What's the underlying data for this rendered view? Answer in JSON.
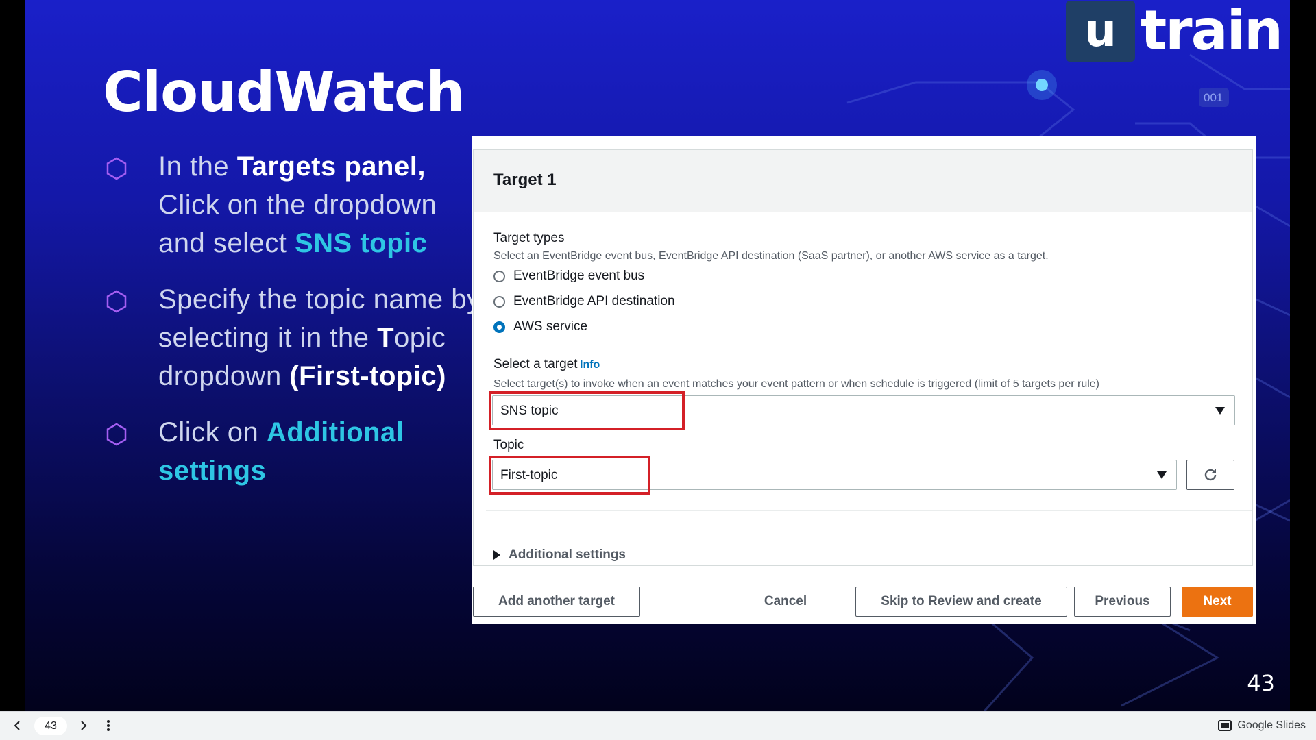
{
  "slide": {
    "title": "CloudWatch",
    "page_number": "43",
    "logo": {
      "box": "u",
      "text": "train"
    },
    "deco_label": "001",
    "bullets": [
      {
        "parts": [
          {
            "text": "In the ",
            "style": "n"
          },
          {
            "text": "Targets panel,",
            "style": "w"
          },
          {
            "text": " Click on the dropdown and select ",
            "style": "n"
          },
          {
            "text": "SNS topic",
            "style": "c"
          }
        ]
      },
      {
        "parts": [
          {
            "text": "Specify the topic name by selecting it in the ",
            "style": "n"
          },
          {
            "text": "T",
            "style": "w"
          },
          {
            "text": "opic dropdown ",
            "style": "n"
          },
          {
            "text": "(First-topic)",
            "style": "w"
          }
        ]
      },
      {
        "parts": [
          {
            "text": "Click on ",
            "style": "n"
          },
          {
            "text": "Additional settings",
            "style": "c"
          }
        ]
      }
    ]
  },
  "aws": {
    "header": "Target 1",
    "target_types_label": "Target types",
    "target_types_desc": "Select an EventBridge event bus, EventBridge API destination (SaaS partner), or another AWS service as a target.",
    "radios": [
      {
        "label": "EventBridge event bus",
        "checked": false
      },
      {
        "label": "EventBridge API destination",
        "checked": false
      },
      {
        "label": "AWS service",
        "checked": true
      }
    ],
    "select_target_label": "Select a target",
    "info_link": "Info",
    "select_target_desc": "Select target(s) to invoke when an event matches your event pattern or when schedule is triggered (limit of 5 targets per rule)",
    "target_value": "SNS topic",
    "topic_label": "Topic",
    "topic_value": "First-topic",
    "additional_settings": "Additional settings",
    "buttons": {
      "add_target": "Add another target",
      "cancel": "Cancel",
      "skip": "Skip to Review and create",
      "previous": "Previous",
      "next": "Next"
    }
  },
  "player": {
    "page": "43",
    "app_name": "Google Slides"
  },
  "colors": {
    "accent_cyan": "#2ec6e4",
    "aws_orange": "#ec7211",
    "highlight_red": "#d42027",
    "bullet_purple": "#a45ef2"
  }
}
